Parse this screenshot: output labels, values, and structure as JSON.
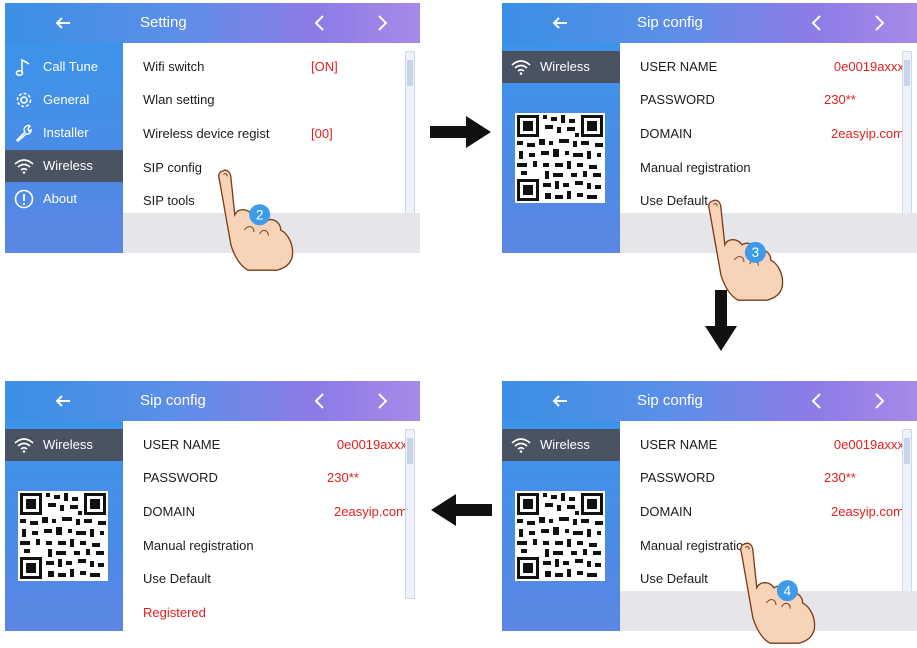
{
  "panel1": {
    "title": "Setting",
    "sidebar": [
      {
        "label": "Call Tune",
        "icon": "music-note-icon"
      },
      {
        "label": "General",
        "icon": "gear-icon"
      },
      {
        "label": "Installer",
        "icon": "wrench-icon"
      },
      {
        "label": "Wireless",
        "icon": "wifi-icon",
        "active": true
      },
      {
        "label": "About",
        "icon": "info-icon"
      }
    ],
    "rows": [
      {
        "label": "Wifi switch",
        "value": "[ON]"
      },
      {
        "label": "Wlan setting",
        "value": ""
      },
      {
        "label": "Wireless device regist",
        "value": "[00]"
      },
      {
        "label": "SIP config",
        "value": ""
      },
      {
        "label": "SIP tools",
        "value": ""
      }
    ],
    "step": "2"
  },
  "panel2": {
    "title": "Sip config",
    "sidebar_label": "Wireless",
    "rows": [
      {
        "label": "USER NAME",
        "value": "0e0019axxx"
      },
      {
        "label": "PASSWORD",
        "value": "230**"
      },
      {
        "label": "DOMAIN",
        "value": "2easyip.com"
      },
      {
        "label": "Manual registration",
        "value": ""
      },
      {
        "label": "Use Default",
        "value": ""
      }
    ],
    "step": "3"
  },
  "panel3": {
    "title": "Sip config",
    "sidebar_label": "Wireless",
    "rows": [
      {
        "label": "USER NAME",
        "value": "0e0019axxx"
      },
      {
        "label": "PASSWORD",
        "value": "230**"
      },
      {
        "label": "DOMAIN",
        "value": "2easyip.com"
      },
      {
        "label": "Manual registration",
        "value": ""
      },
      {
        "label": "Use Default",
        "value": ""
      }
    ],
    "step": "4"
  },
  "panel4": {
    "title": "Sip config",
    "sidebar_label": "Wireless",
    "rows": [
      {
        "label": "USER NAME",
        "value": "0e0019axxx"
      },
      {
        "label": "PASSWORD",
        "value": "230**"
      },
      {
        "label": "DOMAIN",
        "value": "2easyip.com"
      },
      {
        "label": "Manual registration",
        "value": ""
      },
      {
        "label": "Use Default",
        "value": ""
      }
    ],
    "status": "Registered"
  },
  "colors": {
    "accent_value": "#e12020",
    "sidebar_active": "#495362",
    "topbar_start": "#3a8fe5",
    "topbar_end": "#a78ae8",
    "step_badge": "#3e9bea"
  }
}
